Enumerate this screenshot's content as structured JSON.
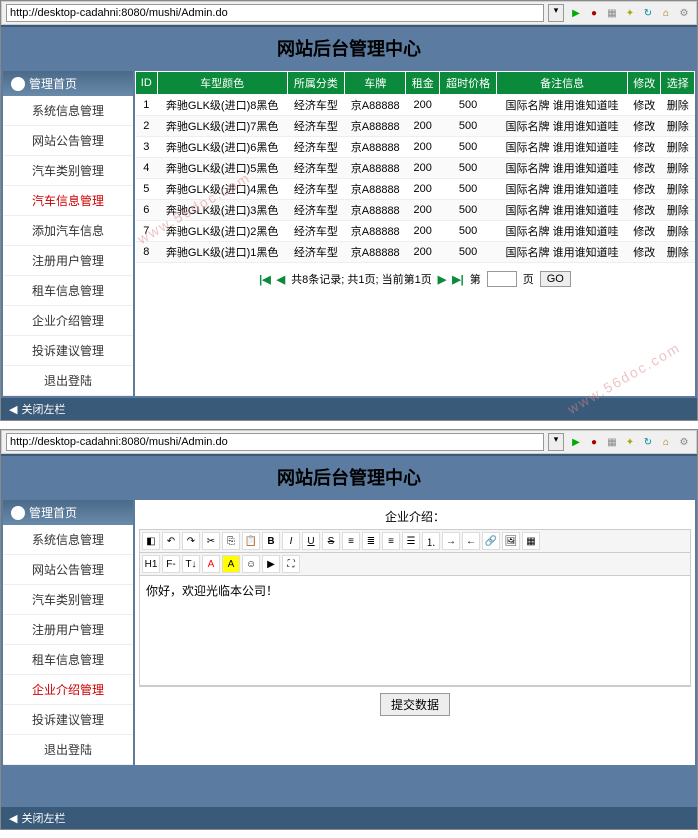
{
  "url": "http://desktop-cadahni:8080/mushi/Admin.do",
  "page_title": "网站后台管理中心",
  "watermark": "www.56doc.com",
  "sidebar_header": "管理首页",
  "footer_text": "关闭左栏",
  "screenshot1": {
    "sidebar": {
      "items": [
        {
          "label": "系统信息管理",
          "active": false
        },
        {
          "label": "网站公告管理",
          "active": false
        },
        {
          "label": "汽车类别管理",
          "active": false
        },
        {
          "label": "汽车信息管理",
          "active": true
        },
        {
          "label": "添加汽车信息",
          "active": false,
          "indent": true
        },
        {
          "label": "注册用户管理",
          "active": false
        },
        {
          "label": "租车信息管理",
          "active": false
        },
        {
          "label": "企业介绍管理",
          "active": false
        },
        {
          "label": "投诉建议管理",
          "active": false
        },
        {
          "label": "退出登陆",
          "active": false
        }
      ]
    },
    "table": {
      "headers": [
        "ID",
        "车型颜色",
        "所属分类",
        "车牌",
        "租金",
        "超时价格",
        "备注信息",
        "修改",
        "选择"
      ],
      "rows": [
        {
          "id": "1",
          "color": "奔驰GLK级(进口)8黑色",
          "category": "经济车型",
          "plate": "京A88888",
          "rent": "200",
          "overtime": "500",
          "note": "国际名牌 谁用谁知道哇",
          "edit": "修改",
          "del": "删除"
        },
        {
          "id": "2",
          "color": "奔驰GLK级(进口)7黑色",
          "category": "经济车型",
          "plate": "京A88888",
          "rent": "200",
          "overtime": "500",
          "note": "国际名牌 谁用谁知道哇",
          "edit": "修改",
          "del": "删除"
        },
        {
          "id": "3",
          "color": "奔驰GLK级(进口)6黑色",
          "category": "经济车型",
          "plate": "京A88888",
          "rent": "200",
          "overtime": "500",
          "note": "国际名牌 谁用谁知道哇",
          "edit": "修改",
          "del": "删除"
        },
        {
          "id": "4",
          "color": "奔驰GLK级(进口)5黑色",
          "category": "经济车型",
          "plate": "京A88888",
          "rent": "200",
          "overtime": "500",
          "note": "国际名牌 谁用谁知道哇",
          "edit": "修改",
          "del": "删除"
        },
        {
          "id": "5",
          "color": "奔驰GLK级(进口)4黑色",
          "category": "经济车型",
          "plate": "京A88888",
          "rent": "200",
          "overtime": "500",
          "note": "国际名牌 谁用谁知道哇",
          "edit": "修改",
          "del": "删除"
        },
        {
          "id": "6",
          "color": "奔驰GLK级(进口)3黑色",
          "category": "经济车型",
          "plate": "京A88888",
          "rent": "200",
          "overtime": "500",
          "note": "国际名牌 谁用谁知道哇",
          "edit": "修改",
          "del": "删除"
        },
        {
          "id": "7",
          "color": "奔驰GLK级(进口)2黑色",
          "category": "经济车型",
          "plate": "京A88888",
          "rent": "200",
          "overtime": "500",
          "note": "国际名牌 谁用谁知道哇",
          "edit": "修改",
          "del": "删除"
        },
        {
          "id": "8",
          "color": "奔驰GLK级(进口)1黑色",
          "category": "经济车型",
          "plate": "京A88888",
          "rent": "200",
          "overtime": "500",
          "note": "国际名牌 谁用谁知道哇",
          "edit": "修改",
          "del": "删除"
        }
      ]
    },
    "pagination": {
      "info": "共8条记录; 共1页; 当前第1页",
      "page_label": "第",
      "page_suffix": "页",
      "go_btn": "GO"
    }
  },
  "screenshot2": {
    "sidebar": {
      "items": [
        {
          "label": "系统信息管理",
          "active": false
        },
        {
          "label": "网站公告管理",
          "active": false
        },
        {
          "label": "汽车类别管理",
          "active": false
        },
        {
          "label": "注册用户管理",
          "active": false
        },
        {
          "label": "租车信息管理",
          "active": false
        },
        {
          "label": "企业介绍管理",
          "active": true
        },
        {
          "label": "投诉建议管理",
          "active": false
        },
        {
          "label": "退出登陆",
          "active": false
        }
      ]
    },
    "editor": {
      "label": "企业介绍：",
      "content": "你好，欢迎光临本公司！",
      "submit_btn": "提交数据"
    }
  }
}
